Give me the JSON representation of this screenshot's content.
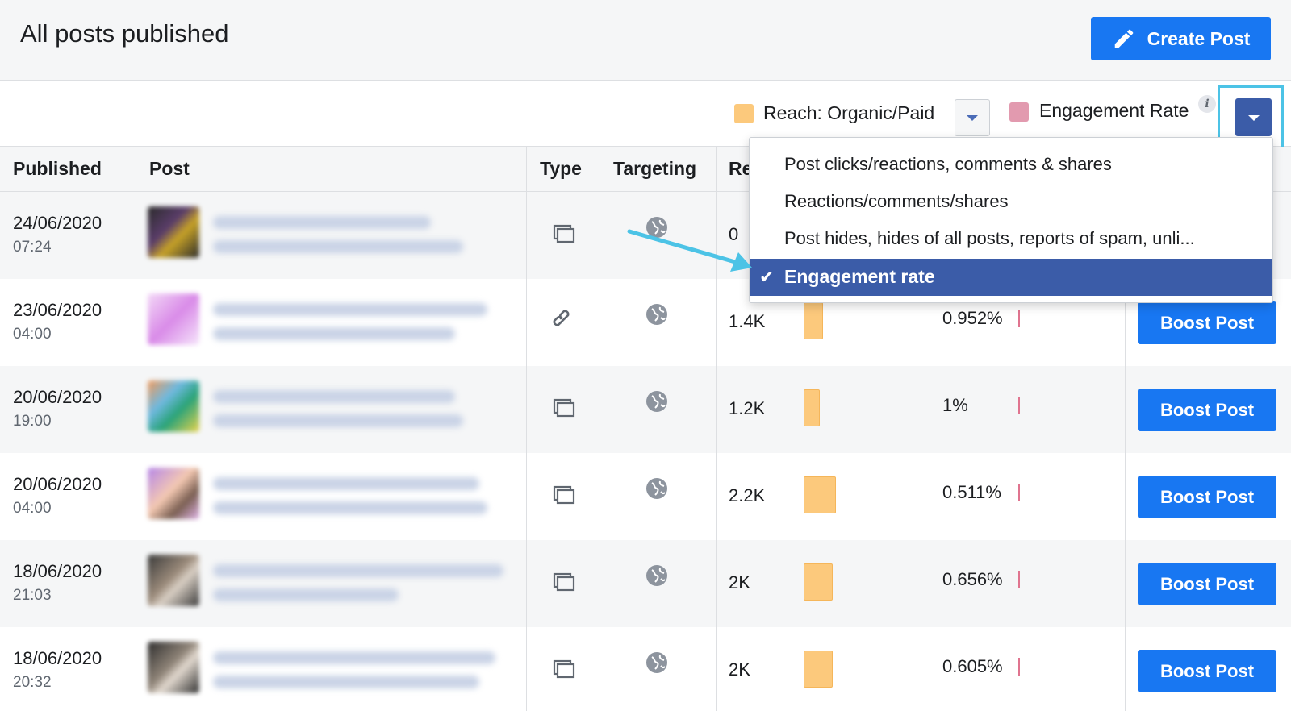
{
  "header": {
    "title": "All posts published",
    "create_post_label": "Create Post"
  },
  "metrics": {
    "reach_label": "Reach: Organic/Paid",
    "reach_color": "#fcc97c",
    "engagement_label": "Engagement Rate",
    "engagement_color": "#e29aaf",
    "info_glyph": "i"
  },
  "table": {
    "columns": [
      "Published",
      "Post",
      "Type",
      "Targeting",
      "Re"
    ],
    "rows": [
      {
        "date": "24/06/2020",
        "time": "07:24",
        "type_icon": "photo-album-icon",
        "reach": "0",
        "reach_level": 0,
        "engagement": "",
        "boost": ""
      },
      {
        "date": "23/06/2020",
        "time": "04:00",
        "type_icon": "link-icon",
        "reach": "1.4K",
        "reach_level": 0.64,
        "engagement": "0.952%",
        "boost": "Boost Post"
      },
      {
        "date": "20/06/2020",
        "time": "19:00",
        "type_icon": "photo-album-icon",
        "reach": "1.2K",
        "reach_level": 0.55,
        "engagement": "1%",
        "boost": "Boost Post"
      },
      {
        "date": "20/06/2020",
        "time": "04:00",
        "type_icon": "photo-album-icon",
        "reach": "2.2K",
        "reach_level": 1.0,
        "engagement": "0.511%",
        "boost": "Boost Post"
      },
      {
        "date": "18/06/2020",
        "time": "21:03",
        "type_icon": "photo-album-icon",
        "reach": "2K",
        "reach_level": 0.9,
        "engagement": "0.656%",
        "boost": "Boost Post"
      },
      {
        "date": "18/06/2020",
        "time": "20:32",
        "type_icon": "photo-album-icon",
        "reach": "2K",
        "reach_level": 0.9,
        "engagement": "0.605%",
        "boost": "Boost Post"
      }
    ]
  },
  "dropdown": {
    "items": [
      "Post clicks/reactions, comments & shares",
      "Reactions/comments/shares",
      "Post hides, hides of all posts, reports of spam, unli..."
    ],
    "selected": "Engagement rate",
    "check_glyph": "✔"
  },
  "colors": {
    "accent": "#1877f2",
    "dropdown_selected": "#3b5ca8",
    "highlight": "#4cc3e6"
  }
}
